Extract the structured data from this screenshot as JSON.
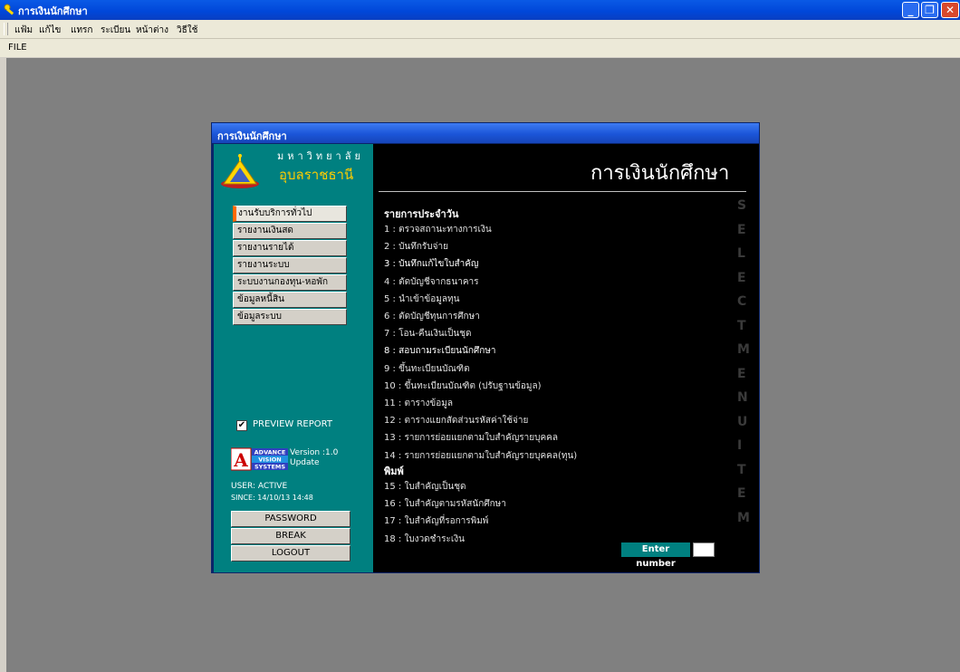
{
  "window": {
    "title": "การเงินนักศึกษา"
  },
  "menubar": {
    "items": [
      "แฟ้ม",
      "แก้ไข",
      "แทรก",
      "ระเบียน",
      "หน้าต่าง",
      "วิธีใช้"
    ]
  },
  "toolbar": {
    "label": "FILE"
  },
  "dialog": {
    "title": "การเงินนักศึกษา",
    "university_line1": "มหาวิทยาลัย",
    "university_line2": "อุบลราชธานี",
    "big_title": "การเงินนักศึกษา",
    "left_menu": [
      "งานรับบริการทั่วไป",
      "รายงานเงินสด",
      "รายงานรายได้",
      "รายงานระบบ",
      "ระบบงานกองทุน-หอพัก",
      "ข้อมูลหนี้สิน",
      "ข้อมูลระบบ"
    ],
    "preview_label": "PREVIEW REPORT",
    "preview_checked": true,
    "advance_logo": [
      "ADVANCE",
      "VISION",
      "SYSTEMS"
    ],
    "version": "Version :1.0",
    "update": "Update",
    "user": "USER: ACTIVE",
    "since": "SINCE: 14/10/13 14:48",
    "buttons": {
      "password": "PASSWORD",
      "break": "BREAK",
      "logout": "LOGOUT"
    },
    "section_daily": "รายการประจำวัน",
    "daily_items": [
      "1 : ตรวจสถานะทางการเงิน",
      "2 : บันทึกรับจ่าย",
      "3 : บันทึกแก้ไขใบสำคัญ",
      "4 : ตัดบัญชีจากธนาคาร",
      "5 : นำเข้าข้อมูลทุน",
      "6 : ตัดบัญชีทุนการศึกษา",
      "7 : โอน-คืนเงินเป็นชุด",
      "8 : สอบถามระเบียนนักศึกษา",
      "9 : ขึ้นทะเบียนบัณฑิต",
      "10 : ขึ้นทะเบียนบัณฑิต (ปรับฐานข้อมูล)",
      "11 : ตารางข้อมูล",
      "12 : ตารางแยกสัดส่วนรหัสค่าใช้จ่าย",
      "13 : รายการย่อยแยกตามใบสำคัญรายบุคคล",
      "14 : รายการย่อยแยกตามใบสำคัญรายบุคคล(ทุน)"
    ],
    "section_print": "พิมพ์",
    "print_items": [
      "15 : ใบสำคัญเป็นชุด",
      "16 : ใบสำคัญตามรหัสนักศึกษา",
      "17 : ใบสำคัญที่รอการพิมพ์",
      "18 : ใบงวดชำระเงิน"
    ],
    "vertical_letters": [
      "S",
      "E",
      "L",
      "E",
      "C",
      "T",
      "M",
      "E",
      "N",
      "U",
      "I",
      "T",
      "E",
      "M"
    ],
    "enter_number_label": "Enter number",
    "enter_number_value": ""
  },
  "colors": {
    "title_blue": "#0a5ae6",
    "dialog_left": "#008080",
    "dialog_right": "#000000",
    "workspace": "#808080",
    "accent": "#ff6a00"
  }
}
